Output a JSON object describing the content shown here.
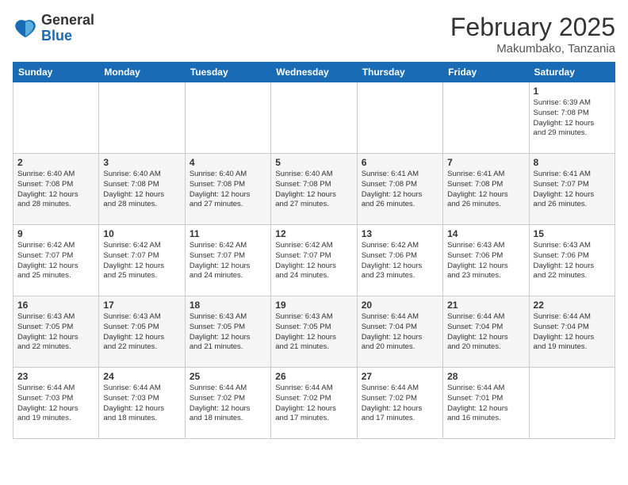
{
  "logo": {
    "general": "General",
    "blue": "Blue"
  },
  "header": {
    "month": "February 2025",
    "location": "Makumbako, Tanzania"
  },
  "weekdays": [
    "Sunday",
    "Monday",
    "Tuesday",
    "Wednesday",
    "Thursday",
    "Friday",
    "Saturday"
  ],
  "weeks": [
    [
      {
        "day": "",
        "info": ""
      },
      {
        "day": "",
        "info": ""
      },
      {
        "day": "",
        "info": ""
      },
      {
        "day": "",
        "info": ""
      },
      {
        "day": "",
        "info": ""
      },
      {
        "day": "",
        "info": ""
      },
      {
        "day": "1",
        "info": "Sunrise: 6:39 AM\nSunset: 7:08 PM\nDaylight: 12 hours\nand 29 minutes."
      }
    ],
    [
      {
        "day": "2",
        "info": "Sunrise: 6:40 AM\nSunset: 7:08 PM\nDaylight: 12 hours\nand 28 minutes."
      },
      {
        "day": "3",
        "info": "Sunrise: 6:40 AM\nSunset: 7:08 PM\nDaylight: 12 hours\nand 28 minutes."
      },
      {
        "day": "4",
        "info": "Sunrise: 6:40 AM\nSunset: 7:08 PM\nDaylight: 12 hours\nand 27 minutes."
      },
      {
        "day": "5",
        "info": "Sunrise: 6:40 AM\nSunset: 7:08 PM\nDaylight: 12 hours\nand 27 minutes."
      },
      {
        "day": "6",
        "info": "Sunrise: 6:41 AM\nSunset: 7:08 PM\nDaylight: 12 hours\nand 26 minutes."
      },
      {
        "day": "7",
        "info": "Sunrise: 6:41 AM\nSunset: 7:08 PM\nDaylight: 12 hours\nand 26 minutes."
      },
      {
        "day": "8",
        "info": "Sunrise: 6:41 AM\nSunset: 7:07 PM\nDaylight: 12 hours\nand 26 minutes."
      }
    ],
    [
      {
        "day": "9",
        "info": "Sunrise: 6:42 AM\nSunset: 7:07 PM\nDaylight: 12 hours\nand 25 minutes."
      },
      {
        "day": "10",
        "info": "Sunrise: 6:42 AM\nSunset: 7:07 PM\nDaylight: 12 hours\nand 25 minutes."
      },
      {
        "day": "11",
        "info": "Sunrise: 6:42 AM\nSunset: 7:07 PM\nDaylight: 12 hours\nand 24 minutes."
      },
      {
        "day": "12",
        "info": "Sunrise: 6:42 AM\nSunset: 7:07 PM\nDaylight: 12 hours\nand 24 minutes."
      },
      {
        "day": "13",
        "info": "Sunrise: 6:42 AM\nSunset: 7:06 PM\nDaylight: 12 hours\nand 23 minutes."
      },
      {
        "day": "14",
        "info": "Sunrise: 6:43 AM\nSunset: 7:06 PM\nDaylight: 12 hours\nand 23 minutes."
      },
      {
        "day": "15",
        "info": "Sunrise: 6:43 AM\nSunset: 7:06 PM\nDaylight: 12 hours\nand 22 minutes."
      }
    ],
    [
      {
        "day": "16",
        "info": "Sunrise: 6:43 AM\nSunset: 7:05 PM\nDaylight: 12 hours\nand 22 minutes."
      },
      {
        "day": "17",
        "info": "Sunrise: 6:43 AM\nSunset: 7:05 PM\nDaylight: 12 hours\nand 22 minutes."
      },
      {
        "day": "18",
        "info": "Sunrise: 6:43 AM\nSunset: 7:05 PM\nDaylight: 12 hours\nand 21 minutes."
      },
      {
        "day": "19",
        "info": "Sunrise: 6:43 AM\nSunset: 7:05 PM\nDaylight: 12 hours\nand 21 minutes."
      },
      {
        "day": "20",
        "info": "Sunrise: 6:44 AM\nSunset: 7:04 PM\nDaylight: 12 hours\nand 20 minutes."
      },
      {
        "day": "21",
        "info": "Sunrise: 6:44 AM\nSunset: 7:04 PM\nDaylight: 12 hours\nand 20 minutes."
      },
      {
        "day": "22",
        "info": "Sunrise: 6:44 AM\nSunset: 7:04 PM\nDaylight: 12 hours\nand 19 minutes."
      }
    ],
    [
      {
        "day": "23",
        "info": "Sunrise: 6:44 AM\nSunset: 7:03 PM\nDaylight: 12 hours\nand 19 minutes."
      },
      {
        "day": "24",
        "info": "Sunrise: 6:44 AM\nSunset: 7:03 PM\nDaylight: 12 hours\nand 18 minutes."
      },
      {
        "day": "25",
        "info": "Sunrise: 6:44 AM\nSunset: 7:02 PM\nDaylight: 12 hours\nand 18 minutes."
      },
      {
        "day": "26",
        "info": "Sunrise: 6:44 AM\nSunset: 7:02 PM\nDaylight: 12 hours\nand 17 minutes."
      },
      {
        "day": "27",
        "info": "Sunrise: 6:44 AM\nSunset: 7:02 PM\nDaylight: 12 hours\nand 17 minutes."
      },
      {
        "day": "28",
        "info": "Sunrise: 6:44 AM\nSunset: 7:01 PM\nDaylight: 12 hours\nand 16 minutes."
      },
      {
        "day": "",
        "info": ""
      }
    ]
  ]
}
